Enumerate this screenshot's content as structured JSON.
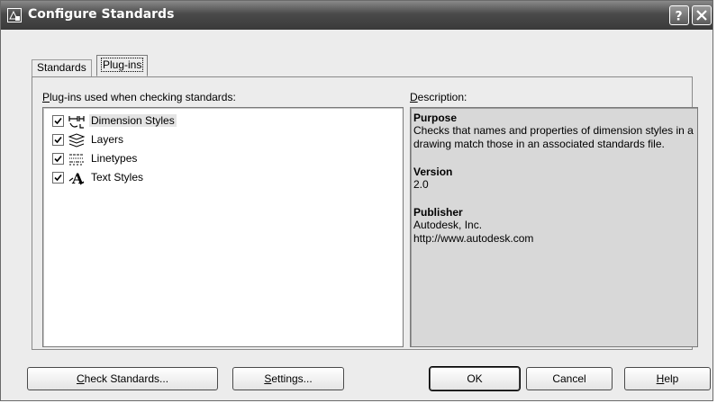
{
  "window": {
    "title": "Configure Standards",
    "help_glyph": "?",
    "close_glyph": "✕"
  },
  "tabs": [
    {
      "label": "Standards",
      "active": false
    },
    {
      "label": "Plug-ins",
      "active": true
    }
  ],
  "plugins_panel": {
    "list_label_underlined": "P",
    "list_label_rest": "lug-ins used when checking standards:",
    "items": [
      {
        "label": "Dimension Styles",
        "checked": true,
        "icon": "dimension-styles-icon",
        "selected": true
      },
      {
        "label": "Layers",
        "checked": true,
        "icon": "layers-icon",
        "selected": false
      },
      {
        "label": "Linetypes",
        "checked": true,
        "icon": "linetypes-icon",
        "selected": false
      },
      {
        "label": "Text Styles",
        "checked": true,
        "icon": "text-styles-icon",
        "selected": false
      }
    ],
    "description_label_underlined": "D",
    "description_label_rest": "escription:",
    "description": {
      "purpose_heading": "Purpose",
      "purpose_text": "Checks that names and properties of dimension styles in a drawing match those in an associated standards file.",
      "version_heading": "Version",
      "version_text": "2.0",
      "publisher_heading": "Publisher",
      "publisher_line1": "Autodesk, Inc.",
      "publisher_line2": "http://www.autodesk.com"
    }
  },
  "buttons": {
    "check_underlined": "C",
    "check_rest": "heck Standards...",
    "settings_underlined": "S",
    "settings_rest": "ettings...",
    "ok": "OK",
    "cancel": "Cancel",
    "help_underlined": "H",
    "help_rest": "elp"
  },
  "colors": {
    "titlebar": "#3a3a3a",
    "dialog_bg": "#ececec",
    "description_bg": "#d8d8d8"
  }
}
